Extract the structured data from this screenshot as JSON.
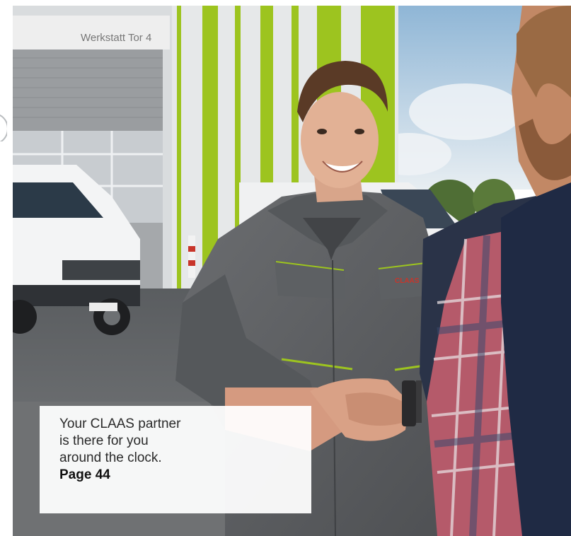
{
  "photo": {
    "sign_text": "Werkstatt  Tor 4",
    "brand_patch": "CLAAS"
  },
  "caption": {
    "line1": "Your CLAAS partner",
    "line2": "is there for you",
    "line3": "around the clock.",
    "page_link": "Page 44"
  },
  "colors": {
    "accent_green": "#9dc41f",
    "workwear_grey": "#5f6163",
    "brand_red": "#c8352a"
  }
}
